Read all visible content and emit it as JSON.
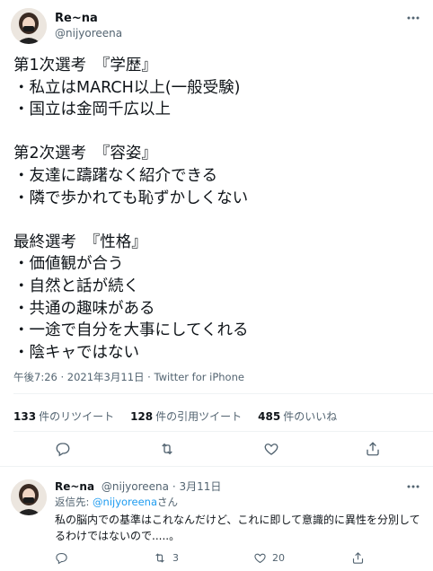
{
  "tweet": {
    "author_name": "Re~na",
    "author_handle": "@nijyoreena",
    "lines": [
      "第1次選考　『学歴』",
      "・私立はMARCH以上(一般受験)",
      "・国立は金岡千広以上",
      "",
      "第2次選考　『容姿』",
      "・友達に躊躇なく紹介できる",
      "・隣で歩かれても恥ずかしくない",
      "",
      "最終選考　『性格』",
      "・価値観が合う",
      "・自然と話が続く",
      "・共通の趣味がある",
      "・一途で自分を大事にしてくれる",
      "・陰キャではない"
    ],
    "timestamp": "午後7:26 · 2021年3月11日 · Twitter for iPhone",
    "stats": {
      "retweets_count": "133",
      "retweets_label": "件のリツイート",
      "quotes_count": "128",
      "quotes_label": "件の引用ツイート",
      "likes_count": "485",
      "likes_label": "件のいいね"
    }
  },
  "reply": {
    "author_name": "Re~na",
    "author_handle": "@nijyoreena",
    "date": "· 3月11日",
    "replying_prefix": "返信先: ",
    "replying_handle": "@nijyoreena",
    "replying_suffix": "さん",
    "text": "私の脳内での基準はこれなんだけど、これに即して意識的に異性を分別してるわけではないので.....。",
    "retweets": "3",
    "likes": "20"
  },
  "icons": {
    "reply": "reply-icon",
    "retweet": "retweet-icon",
    "like": "heart-icon",
    "share": "share-icon",
    "more": "more-icon"
  },
  "colors": {
    "text": "#0f1419",
    "secondary": "#536471",
    "link": "#1d9bf0",
    "divider": "#eff3f4"
  }
}
